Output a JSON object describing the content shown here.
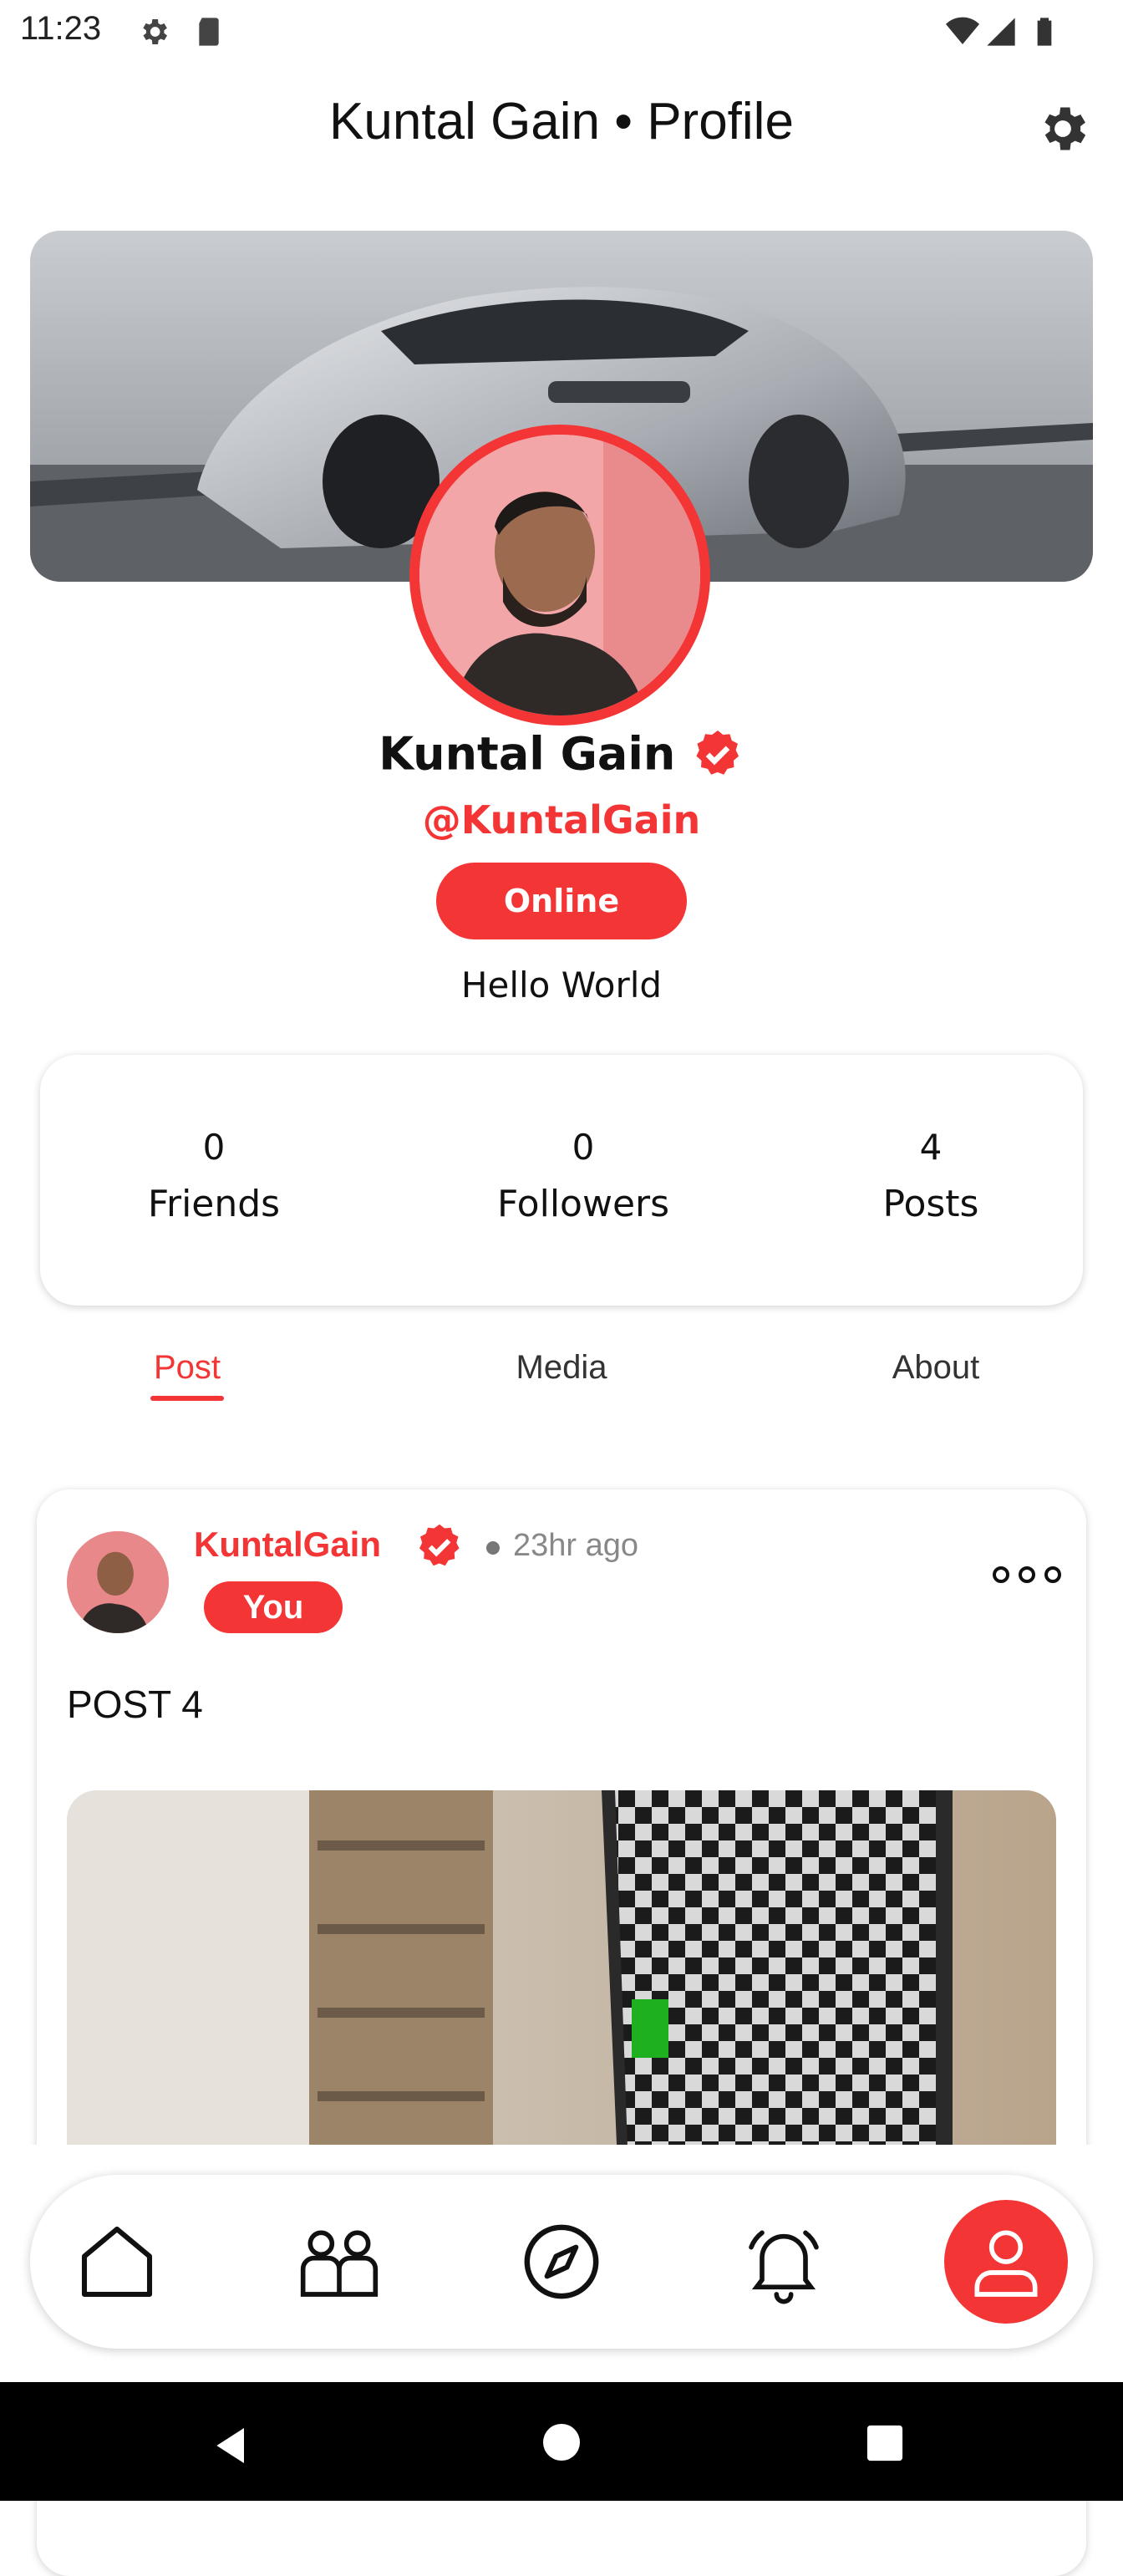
{
  "status_bar": {
    "time": "11:23"
  },
  "header": {
    "title": "Kuntal Gain • Profile"
  },
  "profile": {
    "name": "Kuntal Gain",
    "handle": "@KuntalGain",
    "status": "Online",
    "bio": "Hello World"
  },
  "stats": [
    {
      "value": "0",
      "label": "Friends"
    },
    {
      "value": "0",
      "label": "Followers"
    },
    {
      "value": "4",
      "label": "Posts"
    }
  ],
  "tabs": [
    {
      "label": "Post",
      "active": true
    },
    {
      "label": "Media",
      "active": false
    },
    {
      "label": "About",
      "active": false
    }
  ],
  "post": {
    "author": "KuntalGain",
    "time": "23hr ago",
    "badge": "You",
    "text": "POST 4"
  },
  "colors": {
    "accent": "#f43535",
    "text": "#111111",
    "muted": "#888888"
  },
  "bottom_nav": {
    "items": [
      "home-icon",
      "friends-icon",
      "explore-icon",
      "notifications-icon",
      "profile-icon"
    ],
    "active": "profile-icon"
  }
}
